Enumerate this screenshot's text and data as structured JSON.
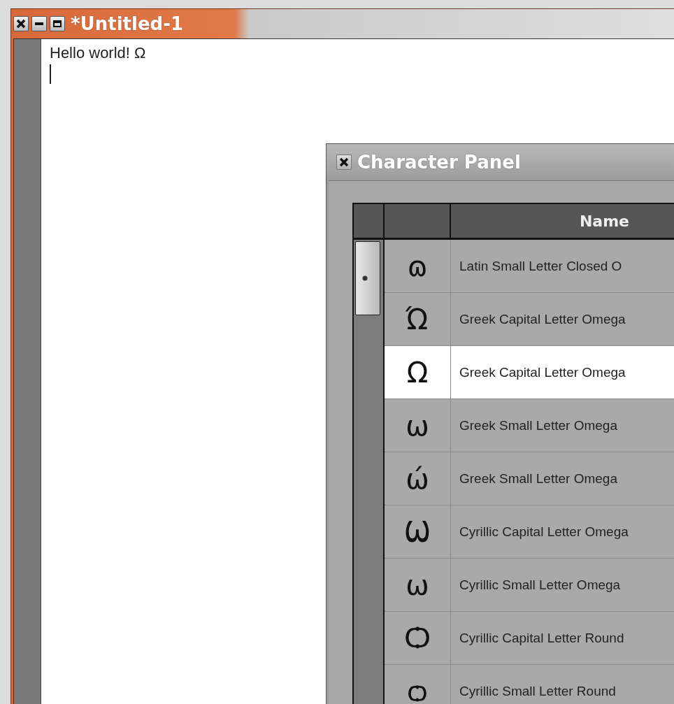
{
  "editor": {
    "title": "*Untitled-1",
    "text": "Hello world! Ω"
  },
  "panel": {
    "title": "Character Panel",
    "columns": [
      "Name"
    ],
    "rows": [
      {
        "char": "ɷ",
        "name": "Latin Small Letter Closed O",
        "selected": false
      },
      {
        "char": "Ώ",
        "name": "Greek Capital Letter Omega",
        "selected": false
      },
      {
        "char": "Ω",
        "name": "Greek Capital Letter Omega",
        "selected": true
      },
      {
        "char": "ω",
        "name": "Greek Small Letter Omega",
        "selected": false
      },
      {
        "char": "ώ",
        "name": "Greek Small Letter Omega",
        "selected": false
      },
      {
        "char": "Ѡ",
        "name": "Cyrillic Capital Letter Omega",
        "selected": false
      },
      {
        "char": "ѡ",
        "name": "Cyrillic Small Letter Omega",
        "selected": false
      },
      {
        "char": "Ѻ",
        "name": "Cyrillic Capital Letter Round",
        "selected": false
      },
      {
        "char": "ѻ",
        "name": "Cyrillic Small Letter Round",
        "selected": false
      }
    ]
  }
}
